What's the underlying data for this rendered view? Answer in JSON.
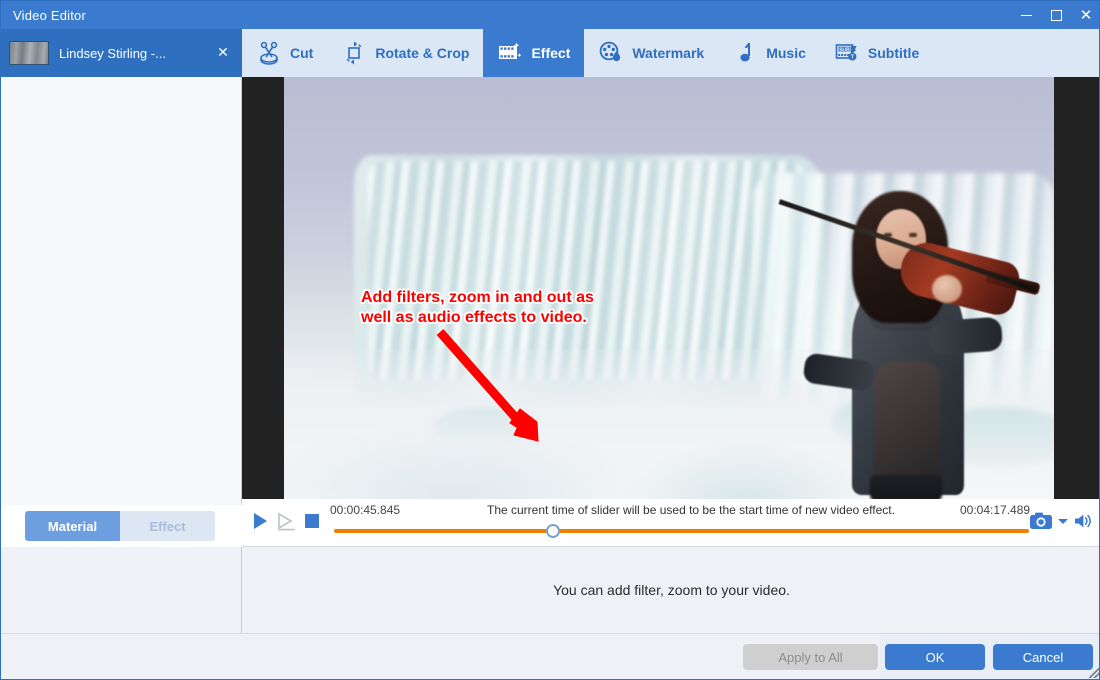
{
  "window": {
    "title": "Video Editor",
    "minimize": "–",
    "maximize": "□",
    "close": "✕"
  },
  "media_tab": {
    "title": "Lindsey Stirling -...",
    "close": "✕",
    "thumbnail": "video-thumbnail"
  },
  "toolbar": {
    "items": [
      {
        "label": "Cut",
        "icon": "scissors-icon",
        "active": false
      },
      {
        "label": "Rotate & Crop",
        "icon": "crop-rotate-icon",
        "active": false
      },
      {
        "label": "Effect",
        "icon": "effect-filmstrip-icon",
        "active": true
      },
      {
        "label": "Watermark",
        "icon": "watermark-droplet-icon",
        "active": false
      },
      {
        "label": "Music",
        "icon": "music-note-icon",
        "active": false
      },
      {
        "label": "Subtitle",
        "icon": "subtitle-icon",
        "active": false
      }
    ]
  },
  "left_panel": {
    "tabs": [
      {
        "label": "Material",
        "active": true
      },
      {
        "label": "Effect",
        "active": false
      }
    ]
  },
  "preview": {
    "callout_text": "Add filters, zoom in and out as\nwell as audio effects to video.",
    "callout_color": "#ff0000",
    "arrow_color": "#ff0000",
    "scene": "violinist-playing-in-snow-with-ice-formations"
  },
  "fx_popup": {
    "expander": "⌄",
    "border_color": "#ff1a1a",
    "buttons": [
      {
        "name": "add-filter",
        "icon": "magic-wand-plus-icon"
      },
      {
        "name": "add-zoom",
        "icon": "magnifier-plus-icon"
      },
      {
        "name": "add-audio-effect",
        "icon": "speaker-plus-icon"
      }
    ]
  },
  "player": {
    "current_time": "00:00:45.845",
    "total_time": "00:04:17.489",
    "hint": "The current time of slider will be used to be the start time of new video effect.",
    "progress_percent": 31,
    "track_color": "#f28000",
    "controls": [
      {
        "name": "play-button",
        "icon": "play-icon",
        "enabled": true
      },
      {
        "name": "step-forward-button",
        "icon": "play-step-icon",
        "enabled": false
      },
      {
        "name": "stop-button",
        "icon": "stop-icon",
        "enabled": true
      }
    ],
    "right_controls": [
      {
        "name": "snapshot-button",
        "icon": "camera-icon"
      },
      {
        "name": "snapshot-dropdown",
        "icon": "chevron-down-icon"
      },
      {
        "name": "volume-button",
        "icon": "speaker-icon"
      }
    ]
  },
  "bottom_panel": {
    "hint": "You can add filter, zoom to your video."
  },
  "footer": {
    "apply_to_all": "Apply to All",
    "apply_to_all_enabled": false,
    "ok": "OK",
    "cancel": "Cancel",
    "accent_color": "#3a7bd0"
  }
}
